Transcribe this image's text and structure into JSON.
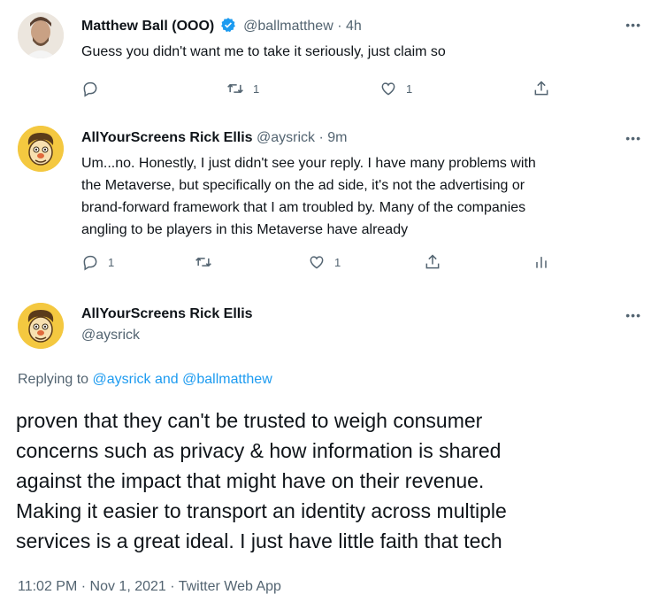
{
  "tweets": [
    {
      "name": "Matthew Ball (OOO)",
      "handle": "@ballmatthew",
      "separator": "·",
      "time": "4h",
      "text": "Guess you didn't want me to take it seriously, just claim so",
      "retweets": "1",
      "likes": "1"
    },
    {
      "name": "AllYourScreens Rick Ellis",
      "handle": "@aysrick",
      "separator": "·",
      "time": "9m",
      "text_lines": [
        "Um...no. Honestly, I just didn't see your reply. I have many problems with",
        "the Metaverse, but specifically on the ad side, it's not the advertising or",
        "brand-forward framework that I am troubled by. Many of the companies",
        "angling to be players in this Metaverse have already"
      ],
      "replies": "1",
      "likes": "1"
    }
  ],
  "main_tweet": {
    "name": "AllYourScreens Rick Ellis",
    "handle": "@aysrick",
    "replying_prefix": "Replying to",
    "replying_to_1": "@aysrick",
    "replying_and": "and",
    "replying_to_2": "@ballmatthew",
    "text_lines": [
      "proven that they can't be trusted to weigh consumer",
      "concerns such as privacy & how information is shared",
      "against the impact that might have on their revenue.",
      "Making it easier to transport an identity across multiple",
      "services is a great ideal. I just have little faith that tech"
    ],
    "timestamp": "11:02 PM · Nov 1, 2021 · Twitter Web App"
  },
  "more_label": "•••",
  "colors": {
    "accent": "#1d9bf0",
    "muted": "#536471",
    "text": "#0f1419"
  }
}
